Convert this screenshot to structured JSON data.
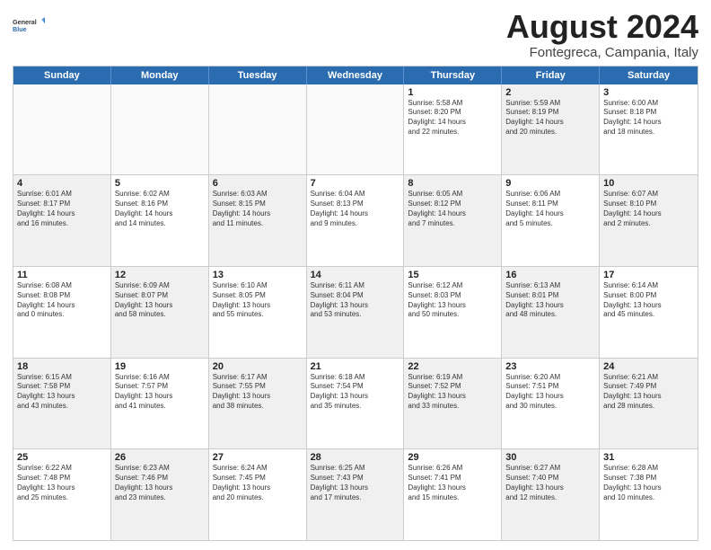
{
  "header": {
    "logo": {
      "general": "General",
      "blue": "Blue"
    },
    "title": "August 2024",
    "subtitle": "Fontegreca, Campania, Italy"
  },
  "calendar": {
    "days_of_week": [
      "Sunday",
      "Monday",
      "Tuesday",
      "Wednesday",
      "Thursday",
      "Friday",
      "Saturday"
    ],
    "weeks": [
      {
        "cells": [
          {
            "day": "",
            "info": "",
            "empty": true
          },
          {
            "day": "",
            "info": "",
            "empty": true
          },
          {
            "day": "",
            "info": "",
            "empty": true
          },
          {
            "day": "",
            "info": "",
            "empty": true
          },
          {
            "day": "1",
            "info": "Sunrise: 5:58 AM\nSunset: 8:20 PM\nDaylight: 14 hours\nand 22 minutes.",
            "shaded": false
          },
          {
            "day": "2",
            "info": "Sunrise: 5:59 AM\nSunset: 8:19 PM\nDaylight: 14 hours\nand 20 minutes.",
            "shaded": true
          },
          {
            "day": "3",
            "info": "Sunrise: 6:00 AM\nSunset: 8:18 PM\nDaylight: 14 hours\nand 18 minutes.",
            "shaded": false
          }
        ]
      },
      {
        "cells": [
          {
            "day": "4",
            "info": "Sunrise: 6:01 AM\nSunset: 8:17 PM\nDaylight: 14 hours\nand 16 minutes.",
            "shaded": true
          },
          {
            "day": "5",
            "info": "Sunrise: 6:02 AM\nSunset: 8:16 PM\nDaylight: 14 hours\nand 14 minutes.",
            "shaded": false
          },
          {
            "day": "6",
            "info": "Sunrise: 6:03 AM\nSunset: 8:15 PM\nDaylight: 14 hours\nand 11 minutes.",
            "shaded": true
          },
          {
            "day": "7",
            "info": "Sunrise: 6:04 AM\nSunset: 8:13 PM\nDaylight: 14 hours\nand 9 minutes.",
            "shaded": false
          },
          {
            "day": "8",
            "info": "Sunrise: 6:05 AM\nSunset: 8:12 PM\nDaylight: 14 hours\nand 7 minutes.",
            "shaded": true
          },
          {
            "day": "9",
            "info": "Sunrise: 6:06 AM\nSunset: 8:11 PM\nDaylight: 14 hours\nand 5 minutes.",
            "shaded": false
          },
          {
            "day": "10",
            "info": "Sunrise: 6:07 AM\nSunset: 8:10 PM\nDaylight: 14 hours\nand 2 minutes.",
            "shaded": true
          }
        ]
      },
      {
        "cells": [
          {
            "day": "11",
            "info": "Sunrise: 6:08 AM\nSunset: 8:08 PM\nDaylight: 14 hours\nand 0 minutes.",
            "shaded": false
          },
          {
            "day": "12",
            "info": "Sunrise: 6:09 AM\nSunset: 8:07 PM\nDaylight: 13 hours\nand 58 minutes.",
            "shaded": true
          },
          {
            "day": "13",
            "info": "Sunrise: 6:10 AM\nSunset: 8:05 PM\nDaylight: 13 hours\nand 55 minutes.",
            "shaded": false
          },
          {
            "day": "14",
            "info": "Sunrise: 6:11 AM\nSunset: 8:04 PM\nDaylight: 13 hours\nand 53 minutes.",
            "shaded": true
          },
          {
            "day": "15",
            "info": "Sunrise: 6:12 AM\nSunset: 8:03 PM\nDaylight: 13 hours\nand 50 minutes.",
            "shaded": false
          },
          {
            "day": "16",
            "info": "Sunrise: 6:13 AM\nSunset: 8:01 PM\nDaylight: 13 hours\nand 48 minutes.",
            "shaded": true
          },
          {
            "day": "17",
            "info": "Sunrise: 6:14 AM\nSunset: 8:00 PM\nDaylight: 13 hours\nand 45 minutes.",
            "shaded": false
          }
        ]
      },
      {
        "cells": [
          {
            "day": "18",
            "info": "Sunrise: 6:15 AM\nSunset: 7:58 PM\nDaylight: 13 hours\nand 43 minutes.",
            "shaded": true
          },
          {
            "day": "19",
            "info": "Sunrise: 6:16 AM\nSunset: 7:57 PM\nDaylight: 13 hours\nand 41 minutes.",
            "shaded": false
          },
          {
            "day": "20",
            "info": "Sunrise: 6:17 AM\nSunset: 7:55 PM\nDaylight: 13 hours\nand 38 minutes.",
            "shaded": true
          },
          {
            "day": "21",
            "info": "Sunrise: 6:18 AM\nSunset: 7:54 PM\nDaylight: 13 hours\nand 35 minutes.",
            "shaded": false
          },
          {
            "day": "22",
            "info": "Sunrise: 6:19 AM\nSunset: 7:52 PM\nDaylight: 13 hours\nand 33 minutes.",
            "shaded": true
          },
          {
            "day": "23",
            "info": "Sunrise: 6:20 AM\nSunset: 7:51 PM\nDaylight: 13 hours\nand 30 minutes.",
            "shaded": false
          },
          {
            "day": "24",
            "info": "Sunrise: 6:21 AM\nSunset: 7:49 PM\nDaylight: 13 hours\nand 28 minutes.",
            "shaded": true
          }
        ]
      },
      {
        "cells": [
          {
            "day": "25",
            "info": "Sunrise: 6:22 AM\nSunset: 7:48 PM\nDaylight: 13 hours\nand 25 minutes.",
            "shaded": false
          },
          {
            "day": "26",
            "info": "Sunrise: 6:23 AM\nSunset: 7:46 PM\nDaylight: 13 hours\nand 23 minutes.",
            "shaded": true
          },
          {
            "day": "27",
            "info": "Sunrise: 6:24 AM\nSunset: 7:45 PM\nDaylight: 13 hours\nand 20 minutes.",
            "shaded": false
          },
          {
            "day": "28",
            "info": "Sunrise: 6:25 AM\nSunset: 7:43 PM\nDaylight: 13 hours\nand 17 minutes.",
            "shaded": true
          },
          {
            "day": "29",
            "info": "Sunrise: 6:26 AM\nSunset: 7:41 PM\nDaylight: 13 hours\nand 15 minutes.",
            "shaded": false
          },
          {
            "day": "30",
            "info": "Sunrise: 6:27 AM\nSunset: 7:40 PM\nDaylight: 13 hours\nand 12 minutes.",
            "shaded": true
          },
          {
            "day": "31",
            "info": "Sunrise: 6:28 AM\nSunset: 7:38 PM\nDaylight: 13 hours\nand 10 minutes.",
            "shaded": false
          }
        ]
      }
    ]
  }
}
